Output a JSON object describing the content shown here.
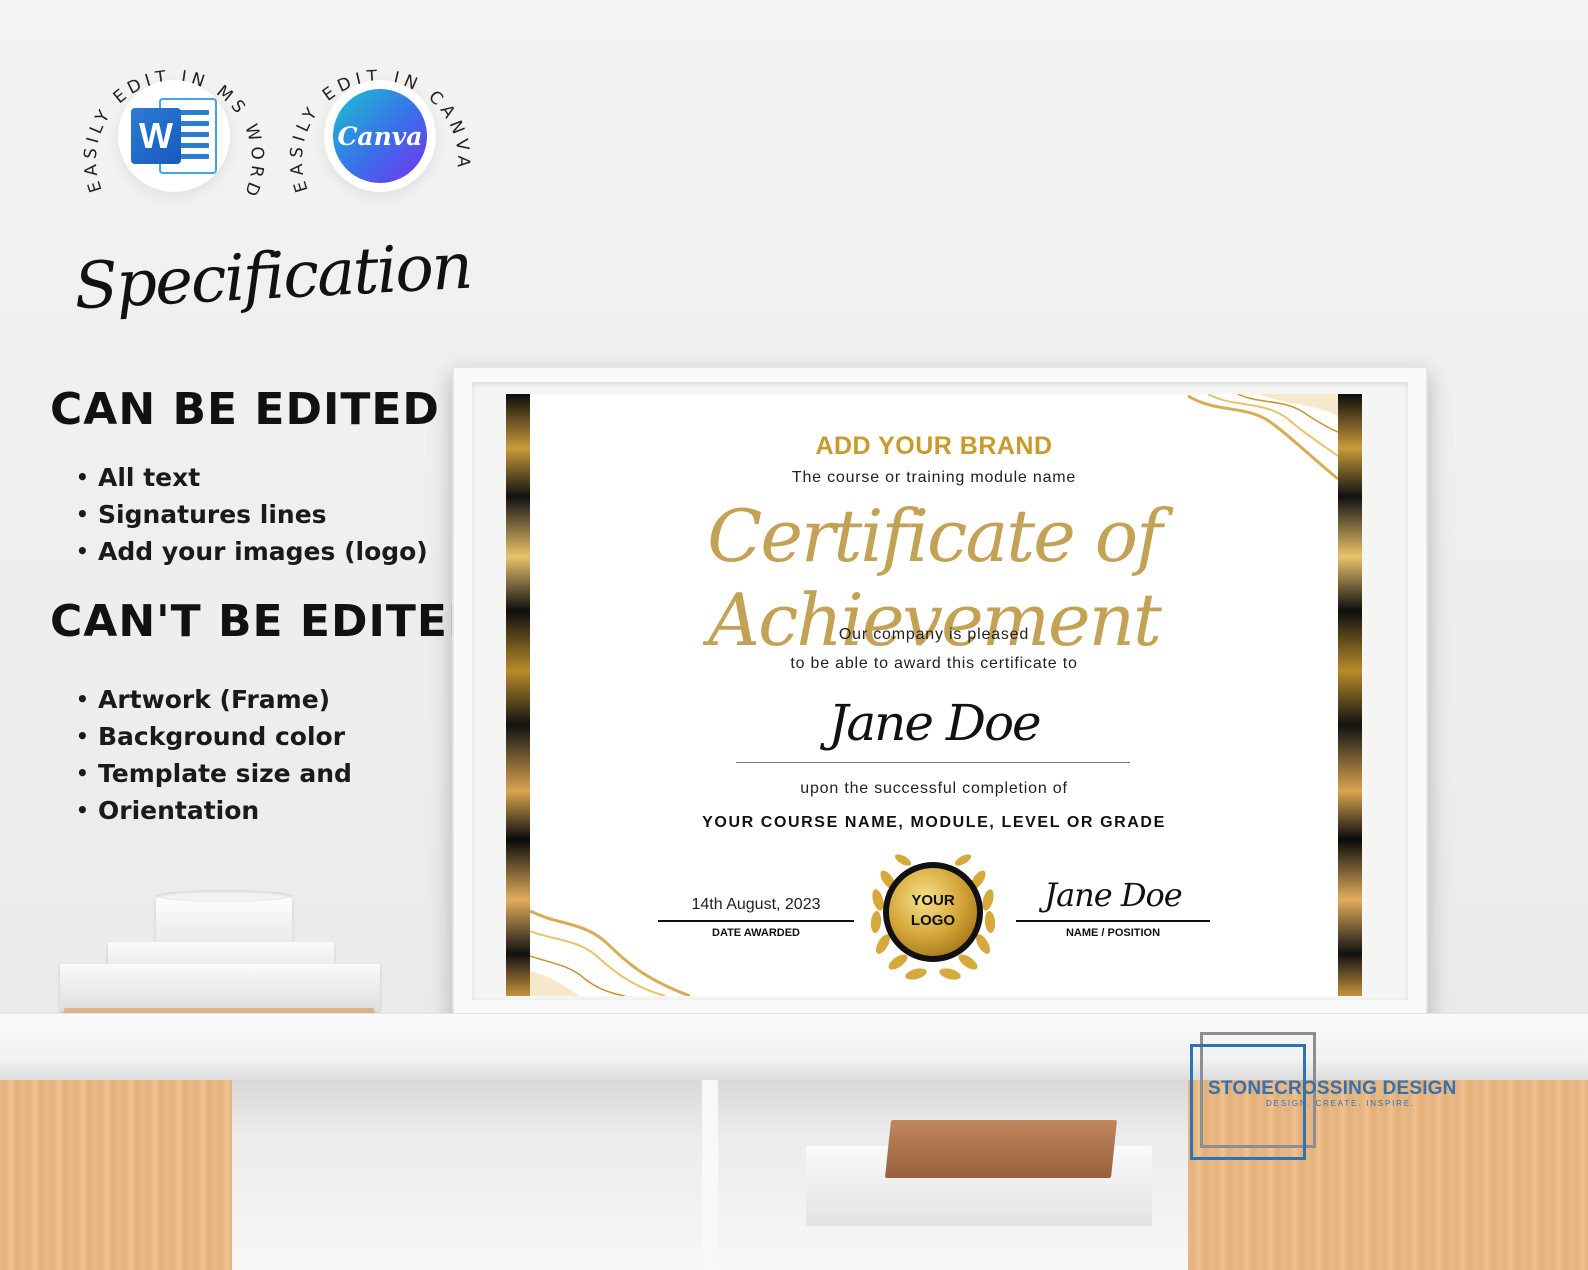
{
  "badges": {
    "word_caption": "EASILY EDIT IN MS WORD",
    "canva_caption": "EASILY EDIT IN CANVA",
    "word_letter": "W",
    "canva_wordmark": "Canva"
  },
  "spec": {
    "title": "Specification",
    "editable_heading": "CAN BE EDITED",
    "editable_items": [
      "All text",
      "Signatures lines",
      "Add your images (logo)"
    ],
    "not_editable_heading": "CAN'T BE EDITED",
    "not_editable_items": [
      "Artwork (Frame)",
      "Background color",
      "Template size and",
      "Orientation"
    ]
  },
  "certificate": {
    "brand": "ADD YOUR BRAND",
    "course_module": "The course or training module name",
    "title": "Certificate of Achievement",
    "pleased_line1": "Our company is pleased",
    "pleased_line2": "to be able to award this certificate to",
    "recipient": "Jane Doe",
    "completion": "upon the successful completion of",
    "course_name": "YOUR COURSE NAME, MODULE, LEVEL OR GRADE",
    "date_value": "14th August, 2023",
    "date_label": "DATE AWARDED",
    "seal_line1": "YOUR",
    "seal_line2": "LOGO",
    "signature": "Jane Doe",
    "signature_label": "NAME / POSITION"
  },
  "watermark": {
    "name": "STONECROSSING DESIGN",
    "tagline": "DESIGN. CREATE. INSPIRE."
  },
  "colors": {
    "gold": "#c89b2c",
    "word_blue": "#2b7cd3",
    "watermark_blue": "#2f73b6"
  }
}
